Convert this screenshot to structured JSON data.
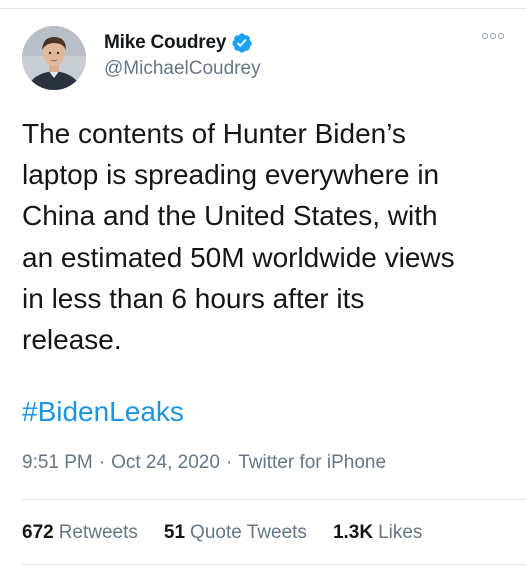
{
  "author": {
    "display_name": "Mike Coudrey",
    "handle": "@MichaelCoudrey",
    "verified": true,
    "avatar_icon": "profile-photo"
  },
  "tweet": {
    "text": "The contents of Hunter Biden’s\nlaptop is spreading everywhere in\nChina and the United States, with\nan estimated 50M worldwide views\nin less than 6 hours after its\nrelease.",
    "hashtag": "#BidenLeaks",
    "time": "9:51 PM",
    "date": "Oct 24, 2020",
    "source": "Twitter for iPhone",
    "separator": "·"
  },
  "stats": {
    "retweets_count": "672",
    "retweets_label": "Retweets",
    "quotes_count": "51",
    "quotes_label": "Quote Tweets",
    "likes_count": "1.3K",
    "likes_label": "Likes"
  },
  "colors": {
    "link": "#1b95e0",
    "verified": "#1da1f2",
    "secondary_text": "#657786",
    "divider": "#e1e8ed"
  }
}
